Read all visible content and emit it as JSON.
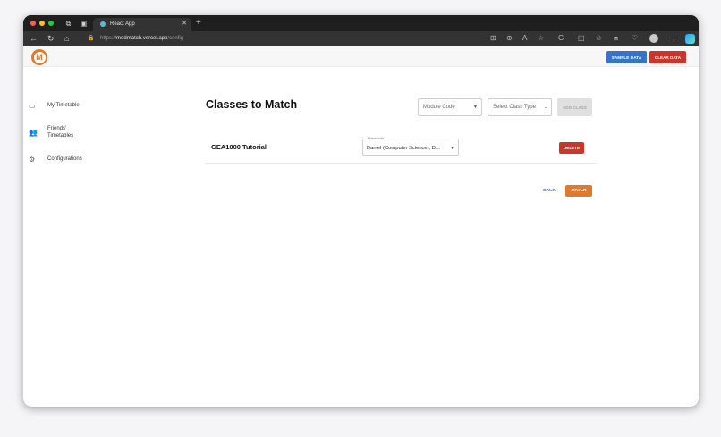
{
  "browser": {
    "tab_title": "React App",
    "tab_close": "✕",
    "new_tab": "+",
    "url_scheme": "https://",
    "url_host": "modmatch.vercel.app",
    "url_path": "/config",
    "traffic_colors": [
      "#ff5f57",
      "#febc2e",
      "#28c840"
    ]
  },
  "appbar": {
    "logo_letter": "M",
    "sample_data_label": "SAMPLE DATA",
    "clear_data_label": "CLEAR DATA"
  },
  "sidebar": {
    "items": [
      {
        "label": "My Timetable",
        "icon": "calendar-icon"
      },
      {
        "label": "Friends' Timetables",
        "icon": "people-icon"
      },
      {
        "label": "Configurations",
        "icon": "gear-icon"
      }
    ]
  },
  "main": {
    "title": "Classes to Match",
    "module_code_placeholder": "Module Code",
    "class_type_placeholder": "Select Class Type",
    "add_class_label": "ADD CLASS",
    "classes": [
      {
        "name": "GEA1000 Tutorial",
        "match_label": "Match with",
        "match_value": "Daniel (Computer Science), D...",
        "delete_label": "DELETE"
      }
    ],
    "back_label": "BACK",
    "match_label": "MATCH"
  },
  "colors": {
    "brand": "#e07a2e",
    "primary": "#3a73c4",
    "danger": "#c9372c"
  }
}
